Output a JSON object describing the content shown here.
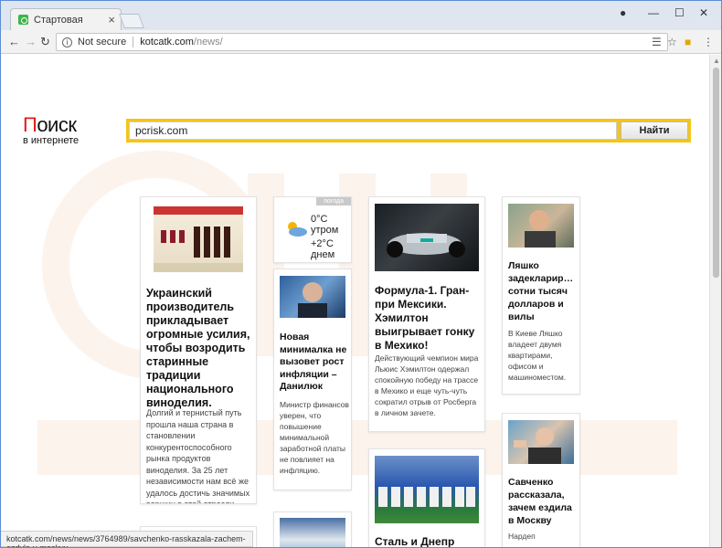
{
  "browser": {
    "tab_title": "Стартовая",
    "security_label": "Not secure",
    "url_host": "kotcatk.com",
    "url_path": "/news/",
    "status_url": "kotcatk.com/news/news/3764989/savchenko-rasskazala-zachem-ezdyla-v-moskvu"
  },
  "logo": {
    "first_letter": "П",
    "rest": "оиск",
    "subtitle": "в интернете"
  },
  "search": {
    "value": "pcrisk.com",
    "button": "Найти"
  },
  "cards": {
    "wine": {
      "title": "Украинский производитель прикладывает огромные усилия, чтобы возродить старинные традиции национального виноделия.",
      "text": "Долгий и тернистый путь прошла наша страна в становлении конкурентоспособного рынка продуктов виноделия. За 25 лет независимости нам всё же удалось достичь значимых вершин в этой отрасли."
    },
    "weather": {
      "tag": "погода",
      "morning": "0°C утром",
      "day": "+2°C днем"
    },
    "danilyuk": {
      "title": "Новая минималка не вызовет рост инфляции – Данилюк",
      "text": "Министр финансов уверен, что повышение минимальной заработной платы не повлияет на инфляцию."
    },
    "f1": {
      "title": "Формула-1. Гран-при Мексики. Хэмилтон выигрывает гонку в Мехико!",
      "text": "Действующий чемпион мира Льюис Хэмилтон одержал спокойную победу на трассе в Мехико и еще чуть-чуть сократил отрыв от Росберга в личном зачете."
    },
    "lyashko": {
      "title": "Ляшко задекларир… сотни тысяч долларов и вилы",
      "text": "В Киеве Ляшко владеет двумя квартирами, офисом и машиноместом."
    },
    "savchenko": {
      "title": "Савченко рассказала, зачем ездила в Москву",
      "text": "Нардеп"
    },
    "dnepr": {
      "title": "Сталь и Днепр"
    }
  }
}
